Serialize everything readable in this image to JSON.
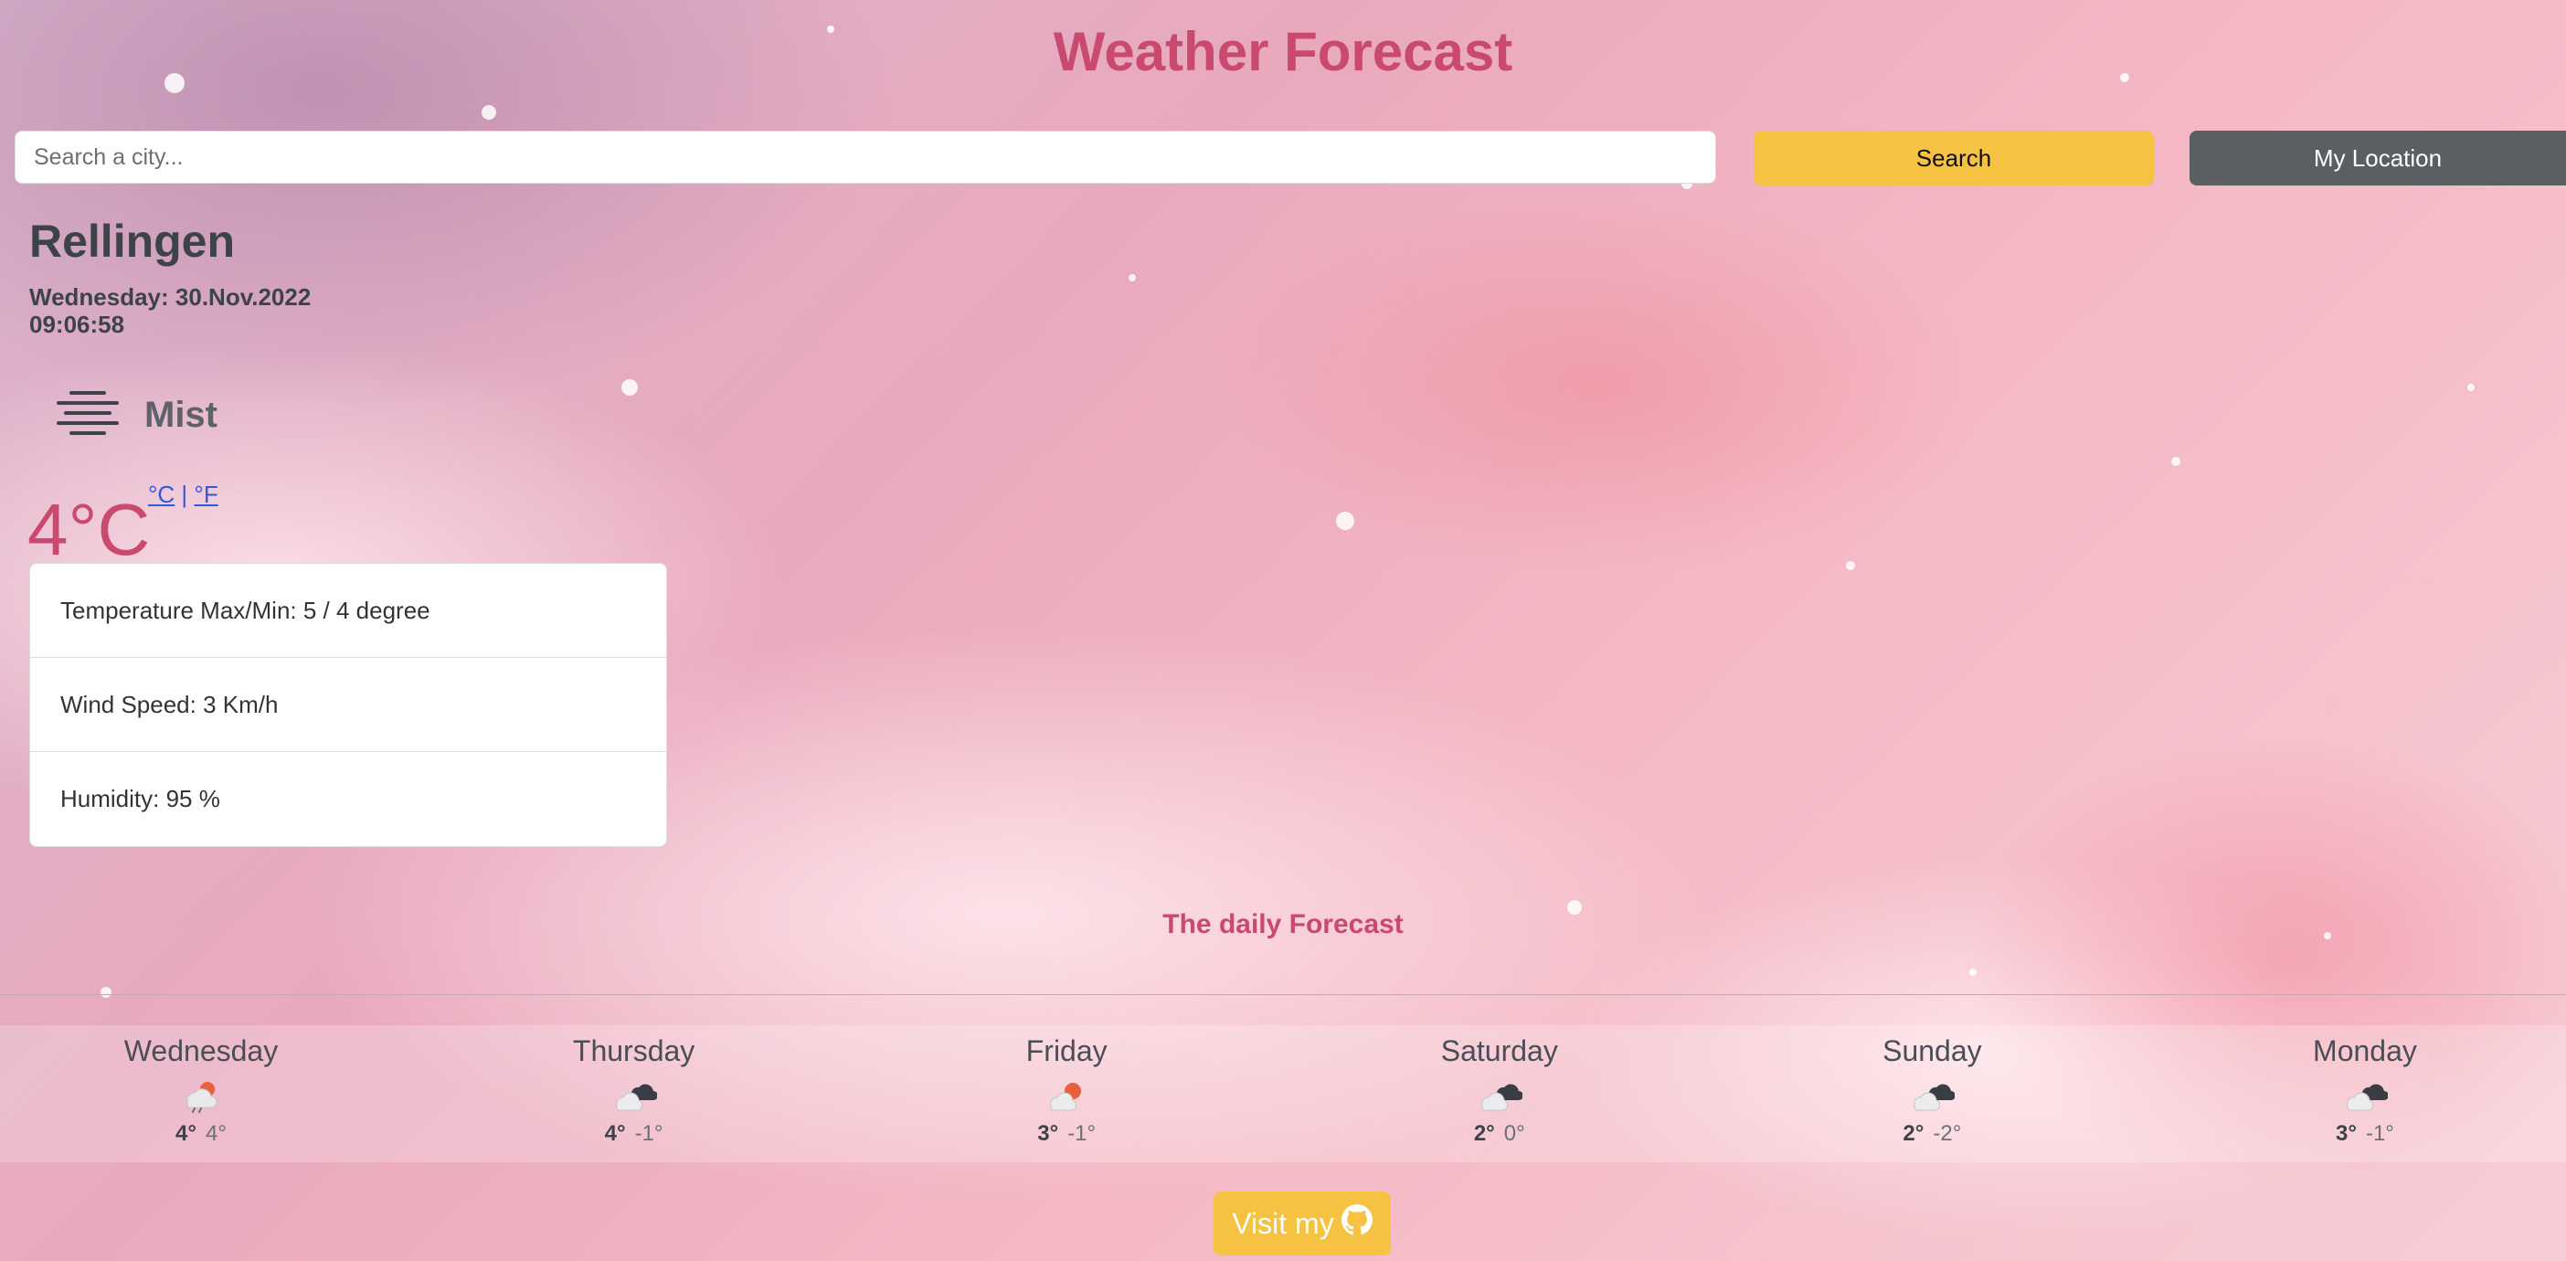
{
  "header": {
    "title": "Weather Forecast"
  },
  "search": {
    "placeholder": "Search a city...",
    "search_label": "Search",
    "location_label": "My Location"
  },
  "current": {
    "city": "Rellingen",
    "date": "Wednesday: 30.Nov.2022",
    "time": "09:06:58",
    "condition": "Mist",
    "condition_icon": "mist-icon",
    "temperature": "4°C",
    "unit_c": "°C",
    "unit_sep": "|",
    "unit_f": "°F",
    "details": [
      "Temperature Max/Min: 5 / 4 degree",
      "Wind Speed: 3 Km/h",
      "Humidity: 95 %"
    ]
  },
  "daily": {
    "heading": "The daily Forecast",
    "days": [
      {
        "name": "Wednesday",
        "icon": "rain-sun-cloud-icon",
        "max": "4°",
        "min": "4°"
      },
      {
        "name": "Thursday",
        "icon": "broken-clouds-icon",
        "max": "4°",
        "min": "-1°"
      },
      {
        "name": "Friday",
        "icon": "sun-cloud-icon",
        "max": "3°",
        "min": "-1°"
      },
      {
        "name": "Saturday",
        "icon": "broken-clouds-icon",
        "max": "2°",
        "min": "0°"
      },
      {
        "name": "Sunday",
        "icon": "broken-clouds-icon",
        "max": "2°",
        "min": "-2°"
      },
      {
        "name": "Monday",
        "icon": "broken-clouds-icon",
        "max": "3°",
        "min": "-1°"
      }
    ]
  },
  "footer": {
    "button_label": "Visit my",
    "button_icon": "github-icon"
  },
  "colors": {
    "accent": "#c9496f",
    "button_yellow": "#f5c242",
    "button_gray": "#5b5e63",
    "link": "#2f5bd6"
  }
}
